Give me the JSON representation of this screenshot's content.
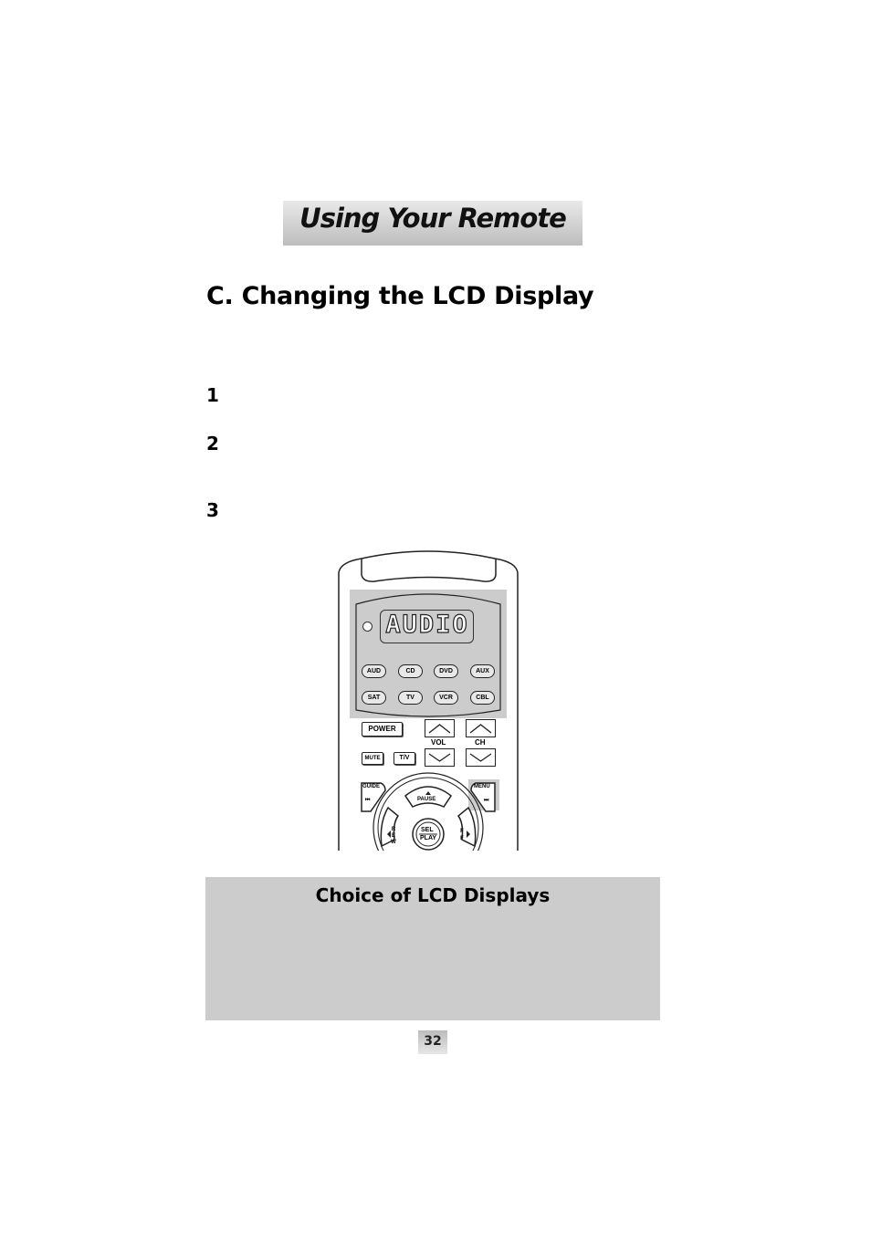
{
  "header": {
    "banner_title": "Using Your Remote"
  },
  "section": {
    "title": "C. Changing the LCD Display"
  },
  "steps": [
    {
      "number": "1"
    },
    {
      "number": "2"
    },
    {
      "number": "3"
    }
  ],
  "remote": {
    "lcd_text": "AUDIO",
    "device_buttons_row1": [
      "AUD",
      "CD",
      "DVD",
      "AUX"
    ],
    "device_buttons_row2": [
      "SAT",
      "TV",
      "VCR",
      "CBL"
    ],
    "power_label": "POWER",
    "mute_label": "MUTE",
    "tv_label": "T/V",
    "vol_label": "VOL",
    "ch_label": "CH",
    "guide_label": "GUIDE",
    "menu_label": "MENU",
    "pause_label": "PAUSE",
    "rew_label": "R E W",
    "ff_label": "F F",
    "sel_label": "SEL",
    "play_label": "PLAY",
    "highlight_color": "#cccccc"
  },
  "info_box": {
    "title": "Choice of LCD Displays",
    "background": "#cccccc"
  },
  "footer": {
    "page_number": "32"
  }
}
